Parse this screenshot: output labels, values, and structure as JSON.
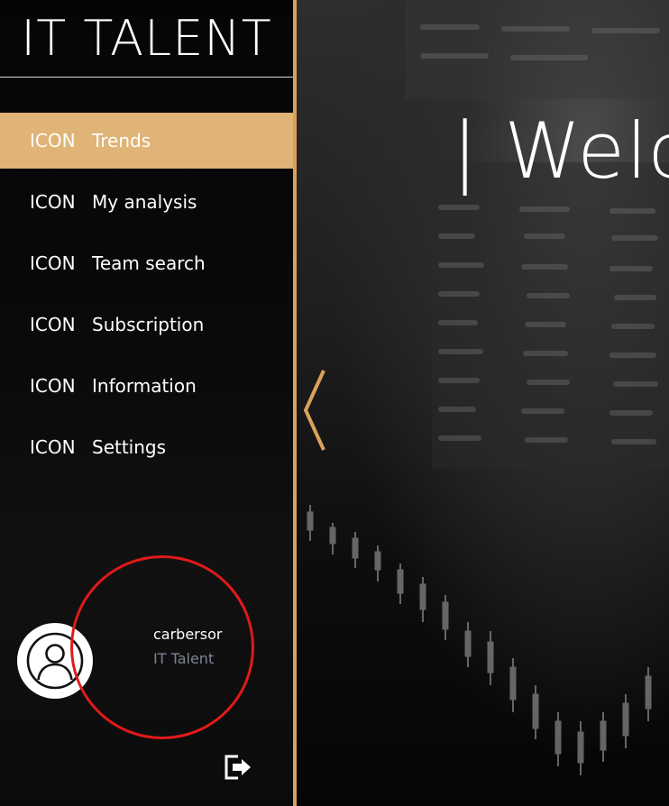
{
  "app": {
    "brand": "IT TALENT"
  },
  "sidebar": {
    "items": [
      {
        "icon": "ICON",
        "label": "Trends",
        "active": true
      },
      {
        "icon": "ICON",
        "label": "My analysis",
        "active": false
      },
      {
        "icon": "ICON",
        "label": "Team search",
        "active": false
      },
      {
        "icon": "ICON",
        "label": "Subscription",
        "active": false
      },
      {
        "icon": "ICON",
        "label": "Information",
        "active": false
      },
      {
        "icon": "ICON",
        "label": "Settings",
        "active": false
      }
    ]
  },
  "user": {
    "name": "carbersor",
    "organization": "IT Talent",
    "avatar_icon": "user-avatar-icon",
    "logout_icon": "logout-icon"
  },
  "main": {
    "welcome": "| Welc",
    "collapse_icon": "chevron-left-icon"
  },
  "colors": {
    "accent": "#e0b376",
    "divider": "#d9a25a",
    "annotation": "#e01a1a",
    "muted_text": "#7d8596"
  }
}
